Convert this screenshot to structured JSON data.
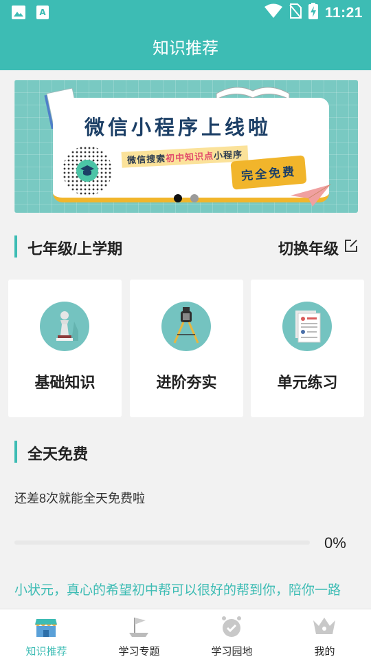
{
  "status_bar": {
    "time": "11:21",
    "icons": [
      "image-icon",
      "a-icon",
      "wifi-icon",
      "no-sim-icon",
      "battery-charging-icon"
    ]
  },
  "nav": {
    "title": "知识推荐"
  },
  "banner": {
    "title": "微信小程序上线啦",
    "tag_prefix": "微信搜索",
    "tag_highlight": "初中知识点",
    "tag_suffix": "小程序",
    "free_label": "完全免费",
    "page_count": 2,
    "active_page": 0
  },
  "grade_section": {
    "title": "七年级/上学期",
    "switch_label": "切换年级"
  },
  "tiles": [
    {
      "label": "基础知识",
      "icon": "chess-pawn-icon"
    },
    {
      "label": "进阶夯实",
      "icon": "compass-icon"
    },
    {
      "label": "单元练习",
      "icon": "document-icon"
    }
  ],
  "free_section": {
    "title": "全天免费",
    "info": "还差8次就能全天免费啦",
    "progress_fraction": 0,
    "progress_label": "0%"
  },
  "slogan": "小状元，真心的希望初中帮可以很好的帮到你，陪你一路",
  "tabbar": [
    {
      "label": "知识推荐",
      "icon": "shop-icon",
      "active": true
    },
    {
      "label": "学习专题",
      "icon": "flag-icon",
      "active": false
    },
    {
      "label": "学习园地",
      "icon": "clock-check-icon",
      "active": false
    },
    {
      "label": "我的",
      "icon": "crown-icon",
      "active": false
    }
  ],
  "colors": {
    "accent": "#3dbcb4",
    "banner_bg": "#79c9c2",
    "yellow": "#f1b52b"
  }
}
